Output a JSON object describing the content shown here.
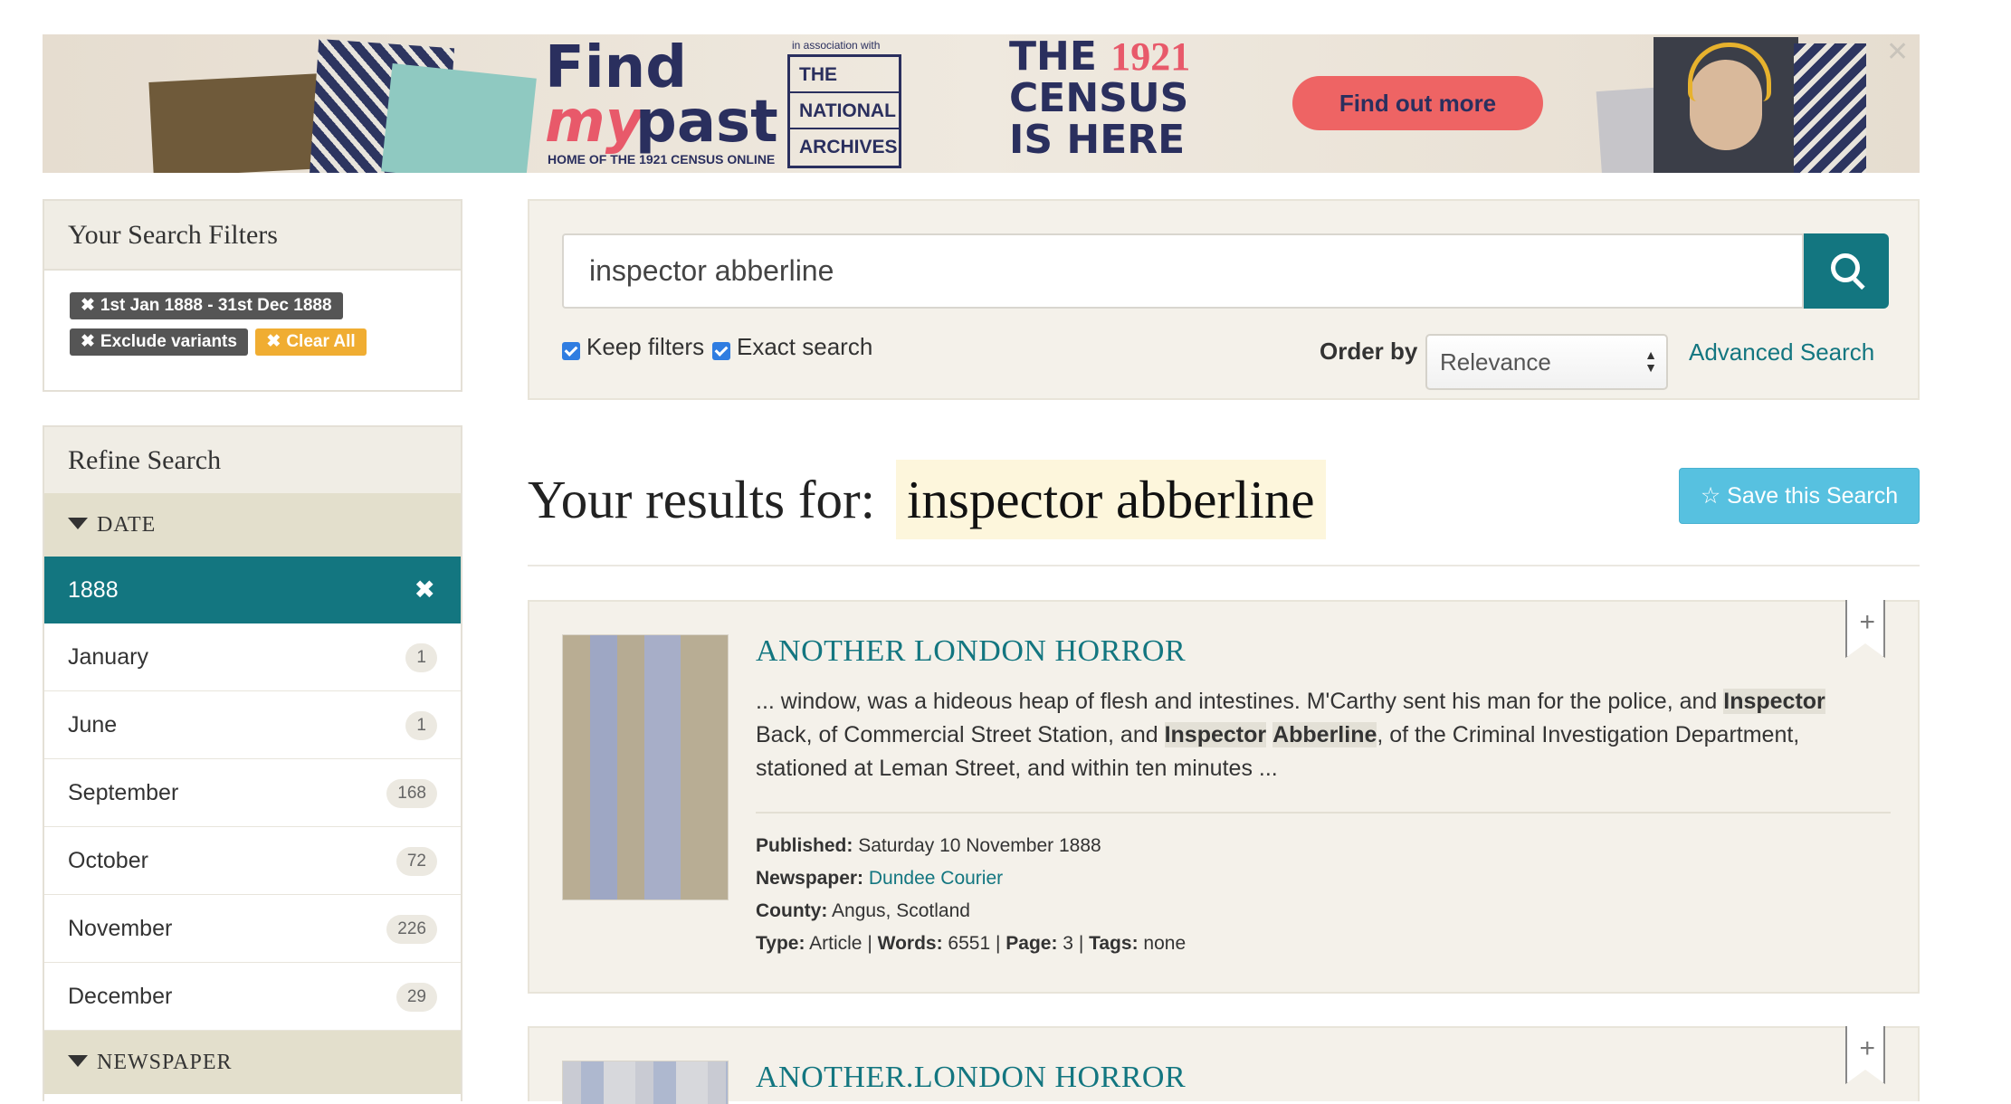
{
  "banner": {
    "find": "Find",
    "my": "my",
    "past": "past",
    "home_line": "HOME OF THE 1921 CENSUS ONLINE",
    "assoc": "in association with",
    "tna": [
      "THE",
      "NATIONAL",
      "ARCHIVES"
    ],
    "census_line1": "THE",
    "census_year": "1921",
    "census_line2": "CENSUS",
    "census_line3": "IS HERE",
    "cta": "Find out more",
    "close": "✕"
  },
  "filters": {
    "title": "Your Search Filters",
    "chips": [
      "1st Jan 1888 - 31st Dec 1888",
      "Exclude variants"
    ],
    "clear_all": "Clear All"
  },
  "refine": {
    "title": "Refine Search",
    "date_heading": "DATE",
    "active": "1888",
    "items": [
      {
        "label": "January",
        "count": "1"
      },
      {
        "label": "June",
        "count": "1"
      },
      {
        "label": "September",
        "count": "168"
      },
      {
        "label": "October",
        "count": "72"
      },
      {
        "label": "November",
        "count": "226"
      },
      {
        "label": "December",
        "count": "29"
      }
    ],
    "newspaper_heading": "NEWSPAPER"
  },
  "search": {
    "query": "inspector abberline",
    "keep_filters": "Keep filters",
    "exact_search": "Exact search",
    "order_label": "Order by",
    "order_value": "Relevance",
    "advanced": "Advanced Search"
  },
  "results": {
    "title": "Your results for:",
    "query": "inspector abberline",
    "save": "Save this Search"
  },
  "cards": [
    {
      "title": "ANOTHER LONDON HORROR",
      "snippet_1": "... window, was a hideous heap of flesh and intestines. M'Carthy sent his man for the police, and ",
      "hl_1": "Inspector",
      "snippet_2": " Back, of Commercial Street Station, and ",
      "hl_2": "Inspector",
      "hl_3": "Abberline",
      "snippet_3": ", of the Criminal Investigation Department, stationed at Leman Street, and within ten minutes ...",
      "published_label": "Published:",
      "published": "Saturday 10 November 1888",
      "newspaper_label": "Newspaper:",
      "newspaper": "Dundee Courier",
      "county_label": "County:",
      "county": "Angus, Scotland",
      "type_label": "Type:",
      "type": "Article",
      "words_label": "Words:",
      "words": "6551",
      "page_label": "Page:",
      "page": "3",
      "tags_label": "Tags:",
      "tags": "none"
    },
    {
      "title": "ANOTHER.LONDON HORROR"
    }
  ],
  "colors": {
    "teal": "#137680",
    "panel": "#f4f1ea",
    "save_button": "#57c1e0",
    "clear_all": "#f0ad32",
    "highlight": "#fdf6dc"
  },
  "icons": [
    "search-icon",
    "close-icon",
    "star-icon",
    "bookmark-plus-icon",
    "caret-down-icon",
    "checkbox-icon"
  ]
}
